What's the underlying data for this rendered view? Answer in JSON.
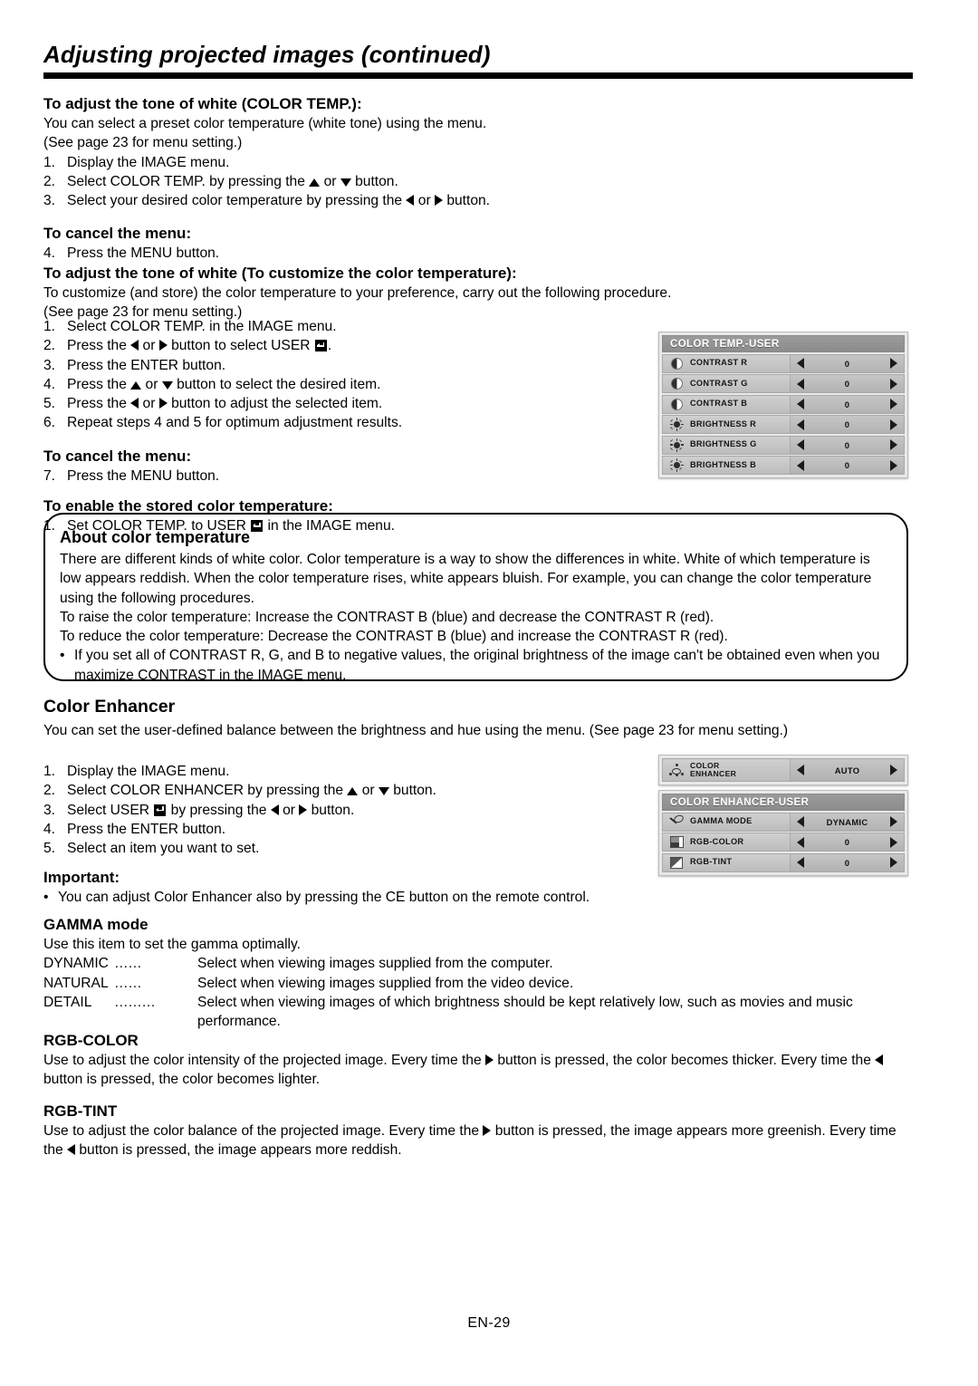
{
  "header": {
    "title": "Adjusting projected images (continued)"
  },
  "section_color_temp": {
    "heading": "To adjust the tone of white (COLOR TEMP.):",
    "intro_line1": "You can select a preset color temperature (white tone) using the menu.",
    "intro_line2": "(See page 23 for menu setting.)",
    "steps": [
      {
        "n": "1.",
        "pre": "Display the IMAGE menu.",
        "post": ""
      },
      {
        "n": "2.",
        "pre": "Select COLOR TEMP. by pressing the ",
        "mid": " or ",
        "post": " button."
      },
      {
        "n": "3.",
        "pre": "Select your desired color temperature by pressing the ",
        "mid": " or ",
        "post": " button."
      }
    ],
    "cancel_heading": "To cancel the menu:",
    "cancel_step": {
      "n": "4.",
      "text": "Press the MENU button."
    }
  },
  "section_customize": {
    "heading": "To adjust the tone of white (To customize the color temperature):",
    "intro_line1": "To customize (and store) the color temperature to your preference, carry out the following procedure.",
    "intro_line2": "(See page 23 for menu setting.)",
    "steps": [
      {
        "n": "1.",
        "text": "Select COLOR TEMP. in the IMAGE menu."
      },
      {
        "n": "2.",
        "a": "Press the ",
        "b": " or ",
        "c": " button to select USER ",
        "d": "."
      },
      {
        "n": "3.",
        "text": "Press the ENTER button."
      },
      {
        "n": "4.",
        "a": "Press the ",
        "b": " or ",
        "c": " button to select the desired item."
      },
      {
        "n": "5.",
        "a": "Press the ",
        "b": " or ",
        "c": " button to adjust the selected item."
      },
      {
        "n": "6.",
        "text": "Repeat steps 4 and 5 for optimum adjustment results."
      }
    ],
    "cancel_heading": "To cancel the menu:",
    "cancel_step": {
      "n": "7.",
      "text": "Press the MENU button."
    },
    "enable_heading": "To enable the stored color temperature:",
    "enable_step": {
      "n": "1.",
      "a": "Set COLOR TEMP. to USER ",
      "b": " in the IMAGE menu."
    }
  },
  "osd_color_temp_user": {
    "title": "COLOR TEMP.-USER",
    "rows": [
      {
        "icon": "contrast-icon",
        "label": "CONTRAST R",
        "value": "0"
      },
      {
        "icon": "contrast-icon",
        "label": "CONTRAST G",
        "value": "0"
      },
      {
        "icon": "contrast-icon",
        "label": "CONTRAST B",
        "value": "0"
      },
      {
        "icon": "brightness-icon",
        "label": "BRIGHTNESS R",
        "value": "0"
      },
      {
        "icon": "brightness-icon",
        "label": "BRIGHTNESS G",
        "value": "0"
      },
      {
        "icon": "brightness-icon",
        "label": "BRIGHTNESS B",
        "value": "0"
      }
    ]
  },
  "callout_about": {
    "heading": "About color temperature",
    "p1": "There are different kinds of white color. Color temperature is a way to show the differences in white. White of which temperature is low appears reddish. When the color temperature rises, white appears bluish. For example, you can change the color temperature using the following procedures.",
    "p2": "To raise the color temperature: Increase the CONTRAST B (blue) and decrease the CONTRAST R (red).",
    "p3": "To reduce the color temperature: Decrease the CONTRAST B (blue) and increase the CONTRAST R (red).",
    "bullet": "If you set all of CONTRAST R, G, and B to negative values, the original brightness of the image can't be obtained even when you maximize CONTRAST in the IMAGE menu."
  },
  "section_color_enhancer": {
    "heading": "Color Enhancer",
    "intro": "You can set the user-defined balance between the brightness and hue using the menu. (See page 23 for menu setting.)",
    "steps": [
      {
        "n": "1.",
        "text": "Display the IMAGE menu."
      },
      {
        "n": "2.",
        "a": "Select COLOR ENHANCER by pressing the ",
        "b": " or ",
        "c": " button."
      },
      {
        "n": "3.",
        "a": "Select USER ",
        "b": " by pressing the ",
        "c": " or ",
        "d": " button."
      },
      {
        "n": "4.",
        "text": "Press the ENTER button."
      },
      {
        "n": "5.",
        "text": "Select an item you want to set."
      }
    ],
    "important_heading": "Important:",
    "important_bullet": "You can adjust Color Enhancer also by pressing the CE button on the remote control."
  },
  "osd_color_enhancer": {
    "icon": "color-enhancer-icon",
    "label_line1": "COLOR",
    "label_line2": "ENHANCER",
    "value": "AUTO"
  },
  "osd_color_enhancer_user": {
    "title": "COLOR ENHANCER-USER",
    "rows": [
      {
        "icon": "gamma-icon",
        "label": "GAMMA MODE",
        "value": "DYNAMIC"
      },
      {
        "icon": "rgb-color-icon",
        "label": "RGB-COLOR",
        "value": "0"
      },
      {
        "icon": "rgb-tint-icon",
        "label": "RGB-TINT",
        "value": "0"
      }
    ]
  },
  "section_gamma": {
    "heading": "GAMMA mode",
    "intro": "Use this item to set the gamma optimally.",
    "items": [
      {
        "key": "DYNAMIC",
        "dots": "……",
        "text": "Select when viewing images supplied from the computer."
      },
      {
        "key": "NATURAL",
        "dots": "……",
        "text": "Select when viewing images supplied from the video device."
      },
      {
        "key": "DETAIL",
        "dots": "………",
        "text": "Select when viewing images of which brightness should be kept relatively low, such as movies and music performance."
      }
    ]
  },
  "section_rgb_color": {
    "heading": "RGB-COLOR",
    "a": "Use to adjust the color intensity of the projected image. Every time the ",
    "b": " button is pressed, the color becomes thicker. Every time the ",
    "c": " button is pressed, the color becomes lighter."
  },
  "section_rgb_tint": {
    "heading": "RGB-TINT",
    "a": "Use to adjust the color balance of the projected image. Every time the ",
    "b": " button is pressed, the image appears more greenish. Every time the ",
    "c": " button is pressed, the image appears more reddish."
  },
  "footer": {
    "page_label": "EN-29"
  }
}
